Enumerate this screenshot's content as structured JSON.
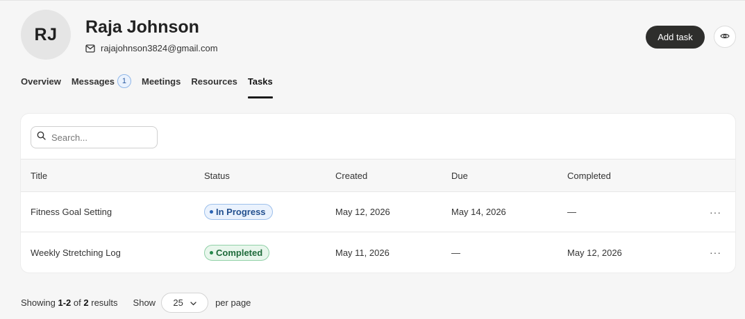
{
  "profile": {
    "initials": "RJ",
    "name": "Raja Johnson",
    "email": "rajajohnson3824@gmail.com",
    "email_icon": "mail-icon",
    "avatar_color": "#e5e5e5"
  },
  "actions": {
    "add_task_label": "Add task",
    "add_task_color": "#2e2e2c",
    "view_icon": "eye-icon"
  },
  "tabs": [
    {
      "label": "Overview",
      "active": false
    },
    {
      "label": "Messages",
      "badge": "1",
      "active": false
    },
    {
      "label": "Meetings",
      "active": false
    },
    {
      "label": "Resources",
      "active": false
    },
    {
      "label": "Tasks",
      "active": true
    }
  ],
  "search": {
    "placeholder": "Search...",
    "value": "",
    "icon": "search-icon"
  },
  "table": {
    "columns": [
      "Title",
      "Status",
      "Created",
      "Due",
      "Completed"
    ],
    "rows": [
      {
        "title": "Fitness Goal Setting",
        "status": "In Progress",
        "status_color": "#2a63b4",
        "created": "May 12, 2026",
        "due": "May 14, 2026",
        "completed": "—",
        "more": "···"
      },
      {
        "title": "Weekly Stretching Log",
        "status": "Completed",
        "status_color": "#24894a",
        "created": "May 11, 2026",
        "due": "—",
        "completed": "May 12, 2026",
        "more": "···"
      }
    ]
  },
  "pagination": {
    "showing_prefix": "Showing",
    "range": "1-2",
    "of_text": "of",
    "total": "2",
    "results_text": "results",
    "show_label": "Show",
    "per_page_value": "25",
    "per_page_label": "per page",
    "chevron_icon": "chevron-down-icon"
  }
}
